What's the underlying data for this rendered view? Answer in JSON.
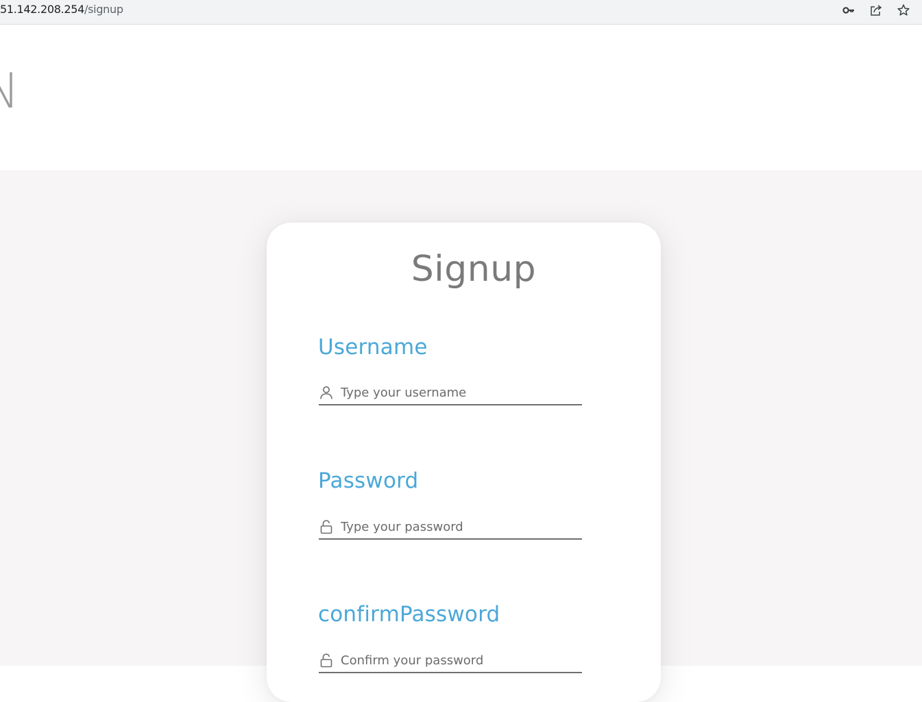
{
  "browser": {
    "url_host": "51.142.208.254",
    "url_path": "/signup",
    "icons": [
      "key-icon",
      "share-icon",
      "star-icon"
    ]
  },
  "header": {
    "logo_fragment": "N"
  },
  "form": {
    "title": "Signup",
    "username": {
      "label": "Username",
      "placeholder": "Type your username",
      "icon": "user-icon"
    },
    "password": {
      "label": "Password",
      "placeholder": "Type your password",
      "icon": "lock-icon"
    },
    "confirm_password": {
      "label": "confirmPassword",
      "placeholder": "Confirm your password",
      "icon": "lock-icon"
    }
  },
  "colors": {
    "label_accent": "#4aa8d8",
    "title": "#7a7a7a",
    "page_background": "#f7f5f6"
  }
}
